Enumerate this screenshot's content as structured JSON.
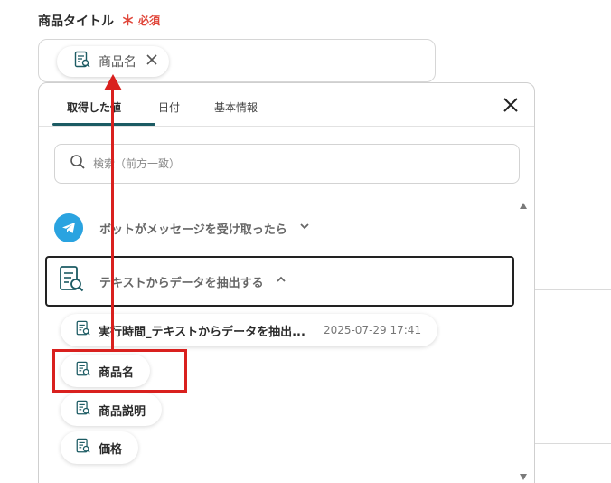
{
  "field": {
    "label": "商品タイトル",
    "required_star": "＊",
    "required_text": "必須",
    "selected_chip": "商品名"
  },
  "tabs": [
    "取得した値",
    "日付",
    "基本情報"
  ],
  "search": {
    "placeholder": "検索（前方一致）"
  },
  "groups": [
    {
      "label": "ボットがメッセージを受け取ったら",
      "icon": "telegram-icon",
      "expanded": false
    },
    {
      "label": "テキストからデータを抽出する",
      "icon": "document-search-icon",
      "expanded": true
    }
  ],
  "items": [
    {
      "label": "実行時間_テキストからデータを抽出...",
      "value": "2025-07-29 17:41"
    },
    {
      "label": "商品名"
    },
    {
      "label": "商品説明"
    },
    {
      "label": "価格"
    }
  ],
  "colors": {
    "accent_teal": "#1c5b63",
    "required_red": "#e0463a",
    "annotation_red": "#d9201e",
    "telegram_blue": "#2aa3e0"
  }
}
